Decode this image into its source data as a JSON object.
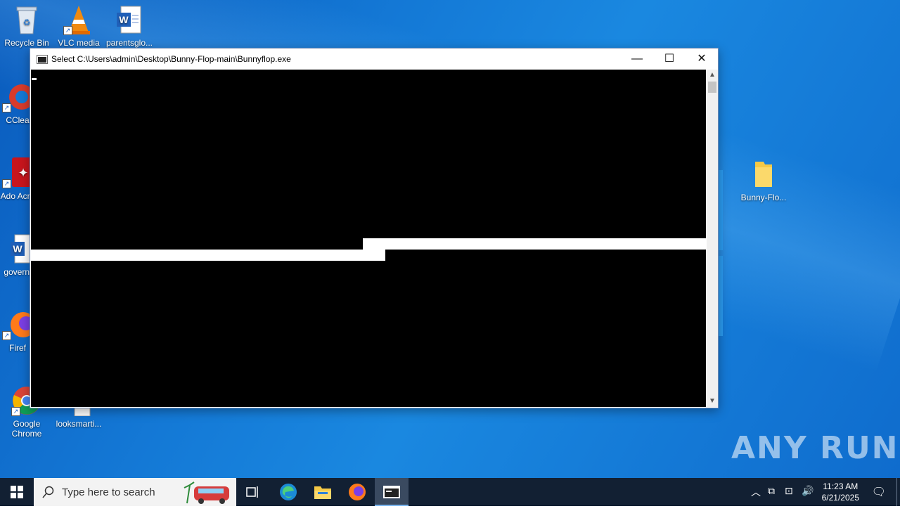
{
  "desktop": {
    "icons": [
      {
        "label": "Recycle Bin"
      },
      {
        "label": "VLC media"
      },
      {
        "label": "parentsglo..."
      },
      {
        "label": "CClea"
      },
      {
        "label": "Ado Acro"
      },
      {
        "label": "governi"
      },
      {
        "label": "Firef"
      },
      {
        "label": "Google Chrome"
      },
      {
        "label": "looksmarti..."
      },
      {
        "label": "Bunny-Flo..."
      }
    ]
  },
  "window": {
    "title": "Select C:\\Users\\admin\\Desktop\\Bunny-Flop-main\\Bunnyflop.exe",
    "minimize_glyph": "—",
    "maximize_glyph": "☐",
    "close_glyph": "✕"
  },
  "taskbar": {
    "search_placeholder": "Type here to search",
    "time": "11:23 AM",
    "date": "6/21/2025"
  },
  "watermark": "ANY RUN",
  "colors": {
    "desktop": "#1479d6",
    "taskbar": "#122033",
    "console": "#000000"
  }
}
